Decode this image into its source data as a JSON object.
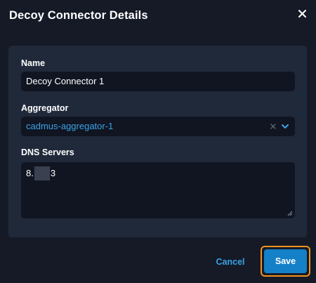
{
  "dialog": {
    "title": "Decoy Connector Details"
  },
  "form": {
    "name": {
      "label": "Name",
      "value": "Decoy Connector 1"
    },
    "aggregator": {
      "label": "Aggregator",
      "value": "cadmus-aggregator-1"
    },
    "dns_servers": {
      "label": "DNS Servers",
      "value_prefix": "8.",
      "value_suffix": "3"
    }
  },
  "actions": {
    "cancel_label": "Cancel",
    "save_label": "Save"
  },
  "colors": {
    "background": "#151a26",
    "panel": "#20293a",
    "input": "#101521",
    "accent": "#39a3e8",
    "primary_button": "#1380c8",
    "focus_outline": "#f2921f"
  },
  "icons": {
    "close": "close-icon",
    "clear": "clear-x-icon",
    "dropdown": "chevron-down-icon",
    "resize": "resize-handle-icon"
  }
}
